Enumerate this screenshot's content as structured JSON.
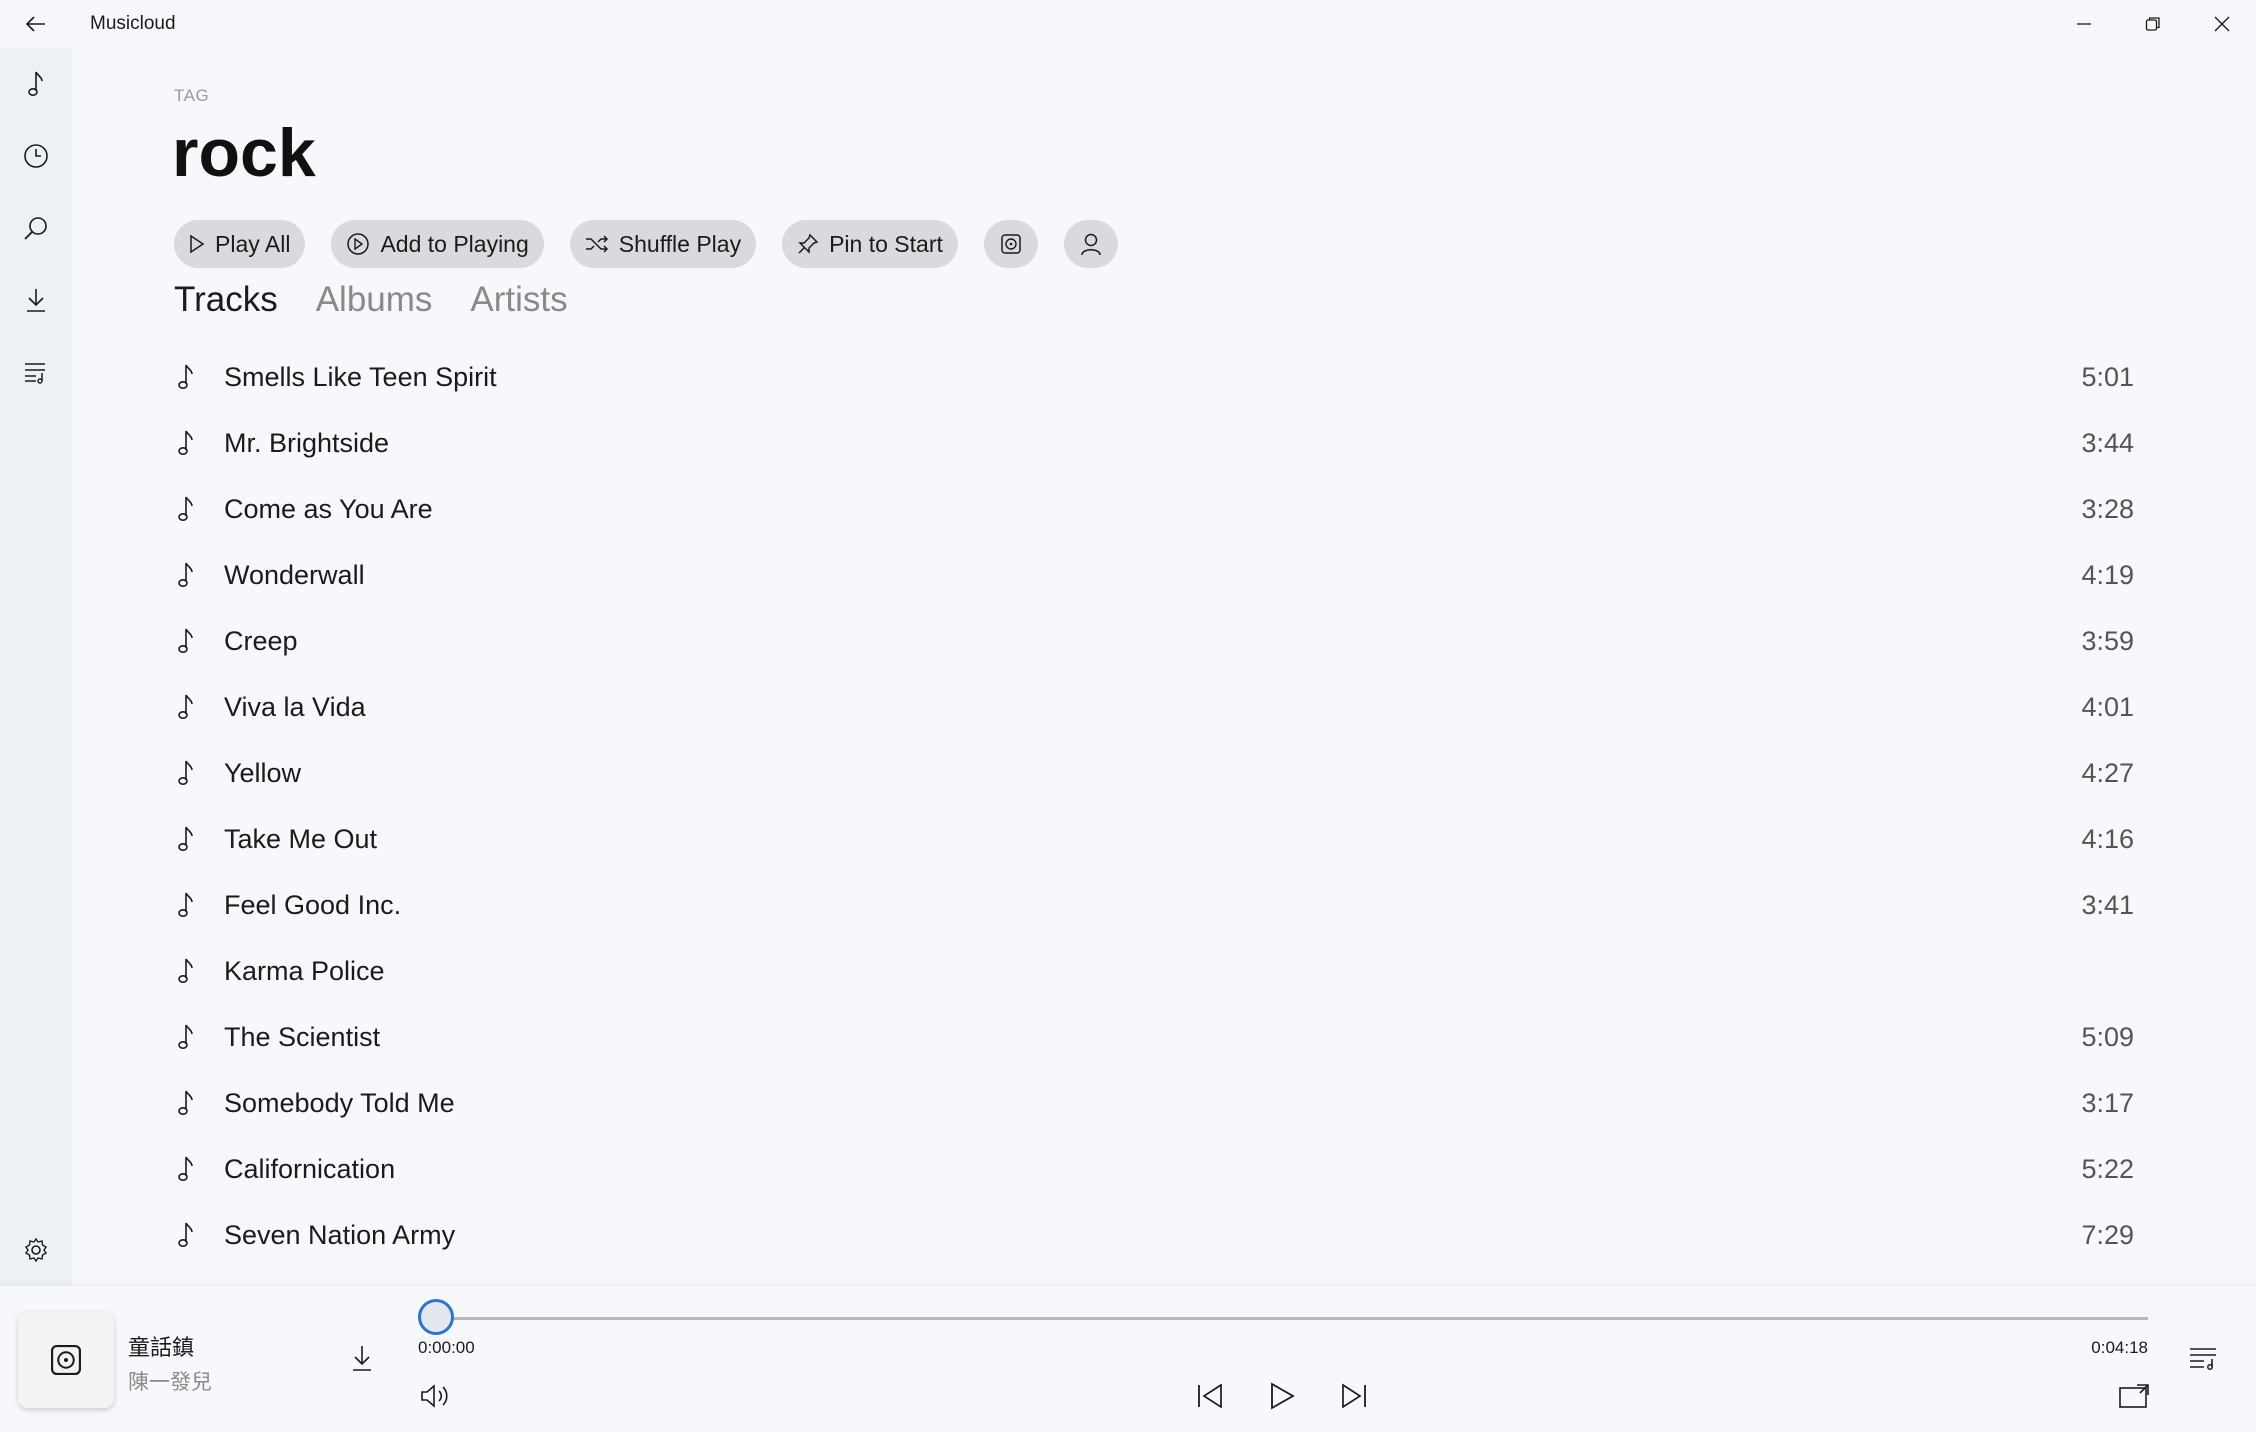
{
  "app": {
    "title": "Musicloud"
  },
  "sidebar": {
    "items": [
      {
        "icon": "music-note-icon"
      },
      {
        "icon": "clock-icon"
      },
      {
        "icon": "search-icon"
      },
      {
        "icon": "download-icon"
      },
      {
        "icon": "playlist-icon"
      }
    ],
    "settings_icon": "gear-icon"
  },
  "header": {
    "label": "TAG",
    "title": "rock"
  },
  "actions": {
    "play_all": "Play All",
    "add_to_playing": "Add to Playing",
    "shuffle_play": "Shuffle Play",
    "pin_to_start": "Pin to Start"
  },
  "tabs": [
    {
      "label": "Tracks",
      "active": true
    },
    {
      "label": "Albums",
      "active": false
    },
    {
      "label": "Artists",
      "active": false
    }
  ],
  "tracks": [
    {
      "name": "Smells Like Teen Spirit",
      "duration": "5:01"
    },
    {
      "name": "Mr. Brightside",
      "duration": "3:44"
    },
    {
      "name": "Come as You Are",
      "duration": "3:28"
    },
    {
      "name": "Wonderwall",
      "duration": "4:19"
    },
    {
      "name": "Creep",
      "duration": "3:59"
    },
    {
      "name": "Viva la Vida",
      "duration": "4:01"
    },
    {
      "name": "Yellow",
      "duration": "4:27"
    },
    {
      "name": "Take Me Out",
      "duration": "4:16"
    },
    {
      "name": "Feel Good Inc.",
      "duration": "3:41"
    },
    {
      "name": "Karma Police",
      "duration": ""
    },
    {
      "name": "The Scientist",
      "duration": "5:09"
    },
    {
      "name": "Somebody Told Me",
      "duration": "3:17"
    },
    {
      "name": "Californication",
      "duration": "5:22"
    },
    {
      "name": "Seven Nation Army",
      "duration": "7:29"
    }
  ],
  "player": {
    "title": "童話鎮",
    "artist": "陳一發兒",
    "current_time": "0:00:00",
    "total_time": "0:04:18",
    "progress": 0,
    "accent": "#2a74d6"
  }
}
